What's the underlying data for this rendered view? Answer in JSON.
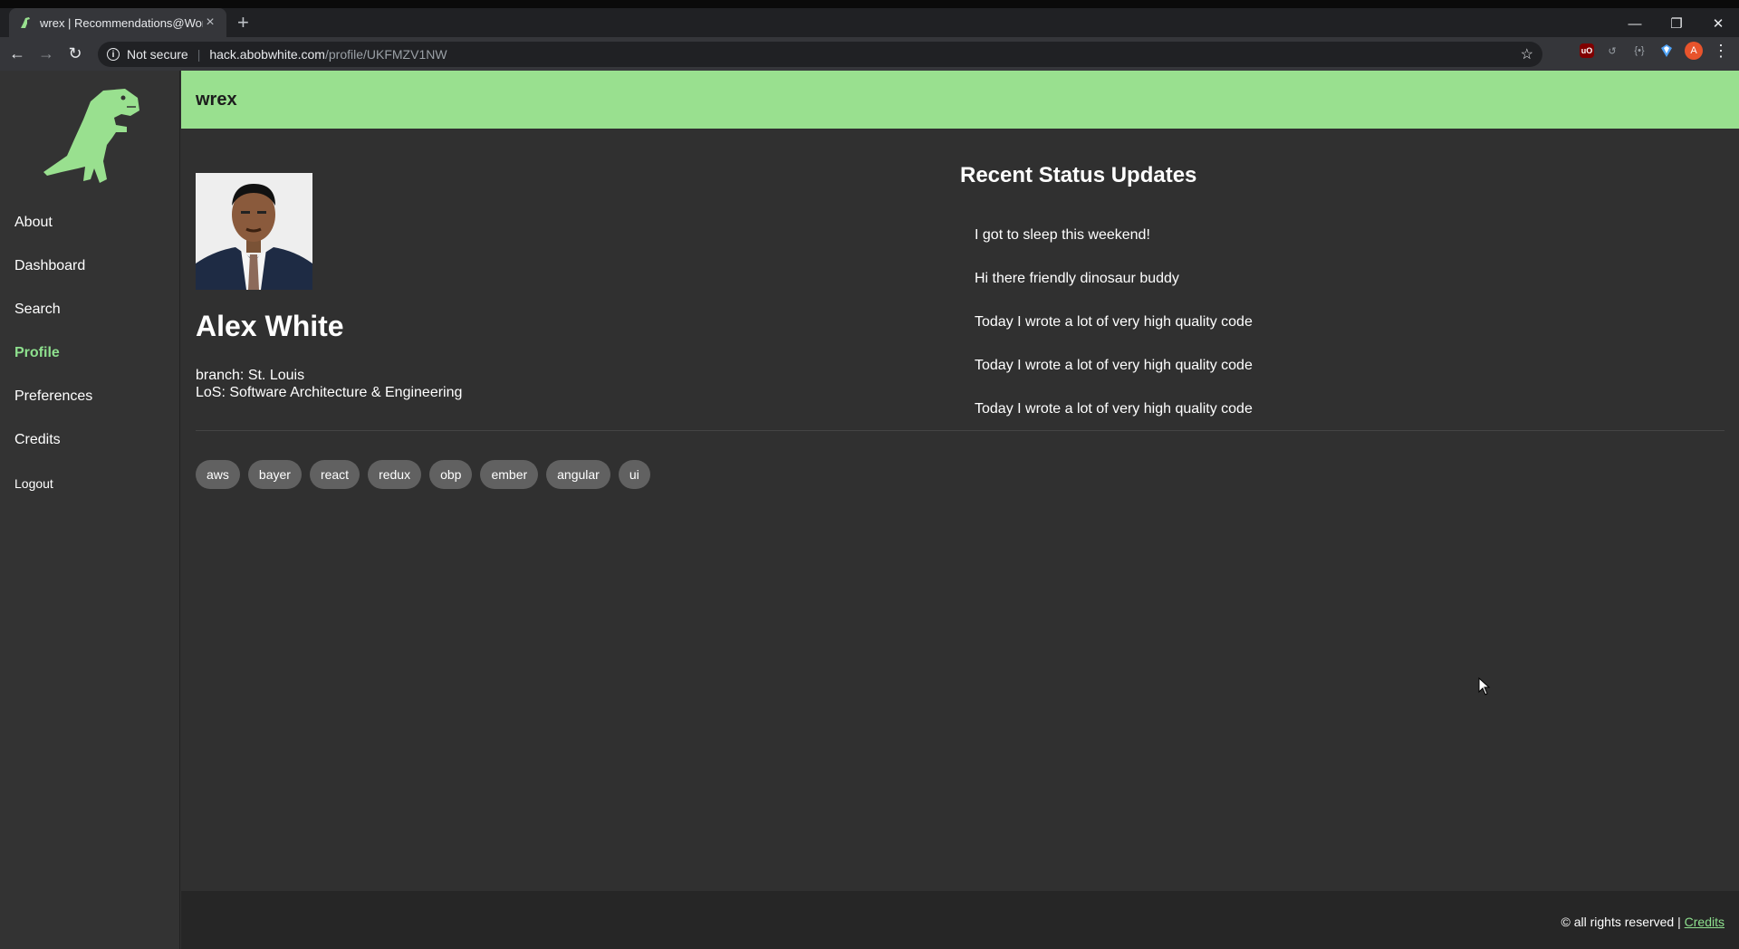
{
  "browser": {
    "tab_title": "wrex | Recommendations@Work",
    "tab_close": "×",
    "new_tab": "+",
    "security_label": "Not secure",
    "url_host": "hack.abobwhite.com",
    "url_path": "/profile/UKFMZV1NW",
    "avatar_letter": "A",
    "ublock_label": "uO"
  },
  "app": {
    "brand": "wrex",
    "nav": [
      {
        "label": "About"
      },
      {
        "label": "Dashboard"
      },
      {
        "label": "Search"
      },
      {
        "label": "Profile",
        "active": true
      },
      {
        "label": "Preferences"
      },
      {
        "label": "Credits"
      },
      {
        "label": "Logout"
      }
    ]
  },
  "profile": {
    "name": "Alex White",
    "branch": "branch: St. Louis",
    "los": "LoS: Software Architecture & Engineering",
    "tags": [
      "aws",
      "bayer",
      "react",
      "redux",
      "obp",
      "ember",
      "angular",
      "ui"
    ]
  },
  "status": {
    "title": "Recent Status Updates",
    "items": [
      "I got to sleep this weekend!",
      "Hi there friendly dinosaur buddy",
      "Today I wrote a lot of very high quality code",
      "Today I wrote a lot of very high quality code",
      "Today I wrote a lot of very high quality code"
    ]
  },
  "footer": {
    "text": "© all rights reserved | ",
    "link": "Credits"
  },
  "colors": {
    "accent_green": "#99e08f",
    "active_nav": "#8ee08e",
    "content_bg": "#303030",
    "sidebar_bg": "#333333",
    "tag_bg": "#616161"
  },
  "icons": {
    "tab_favicon": "dinosaur-icon",
    "back": "back-arrow-icon",
    "forward": "forward-arrow-icon",
    "reload": "reload-icon",
    "info": "info-icon",
    "bookmark": "star-icon",
    "logo": "dinosaur-logo",
    "cursor": "mouse-pointer-icon"
  }
}
